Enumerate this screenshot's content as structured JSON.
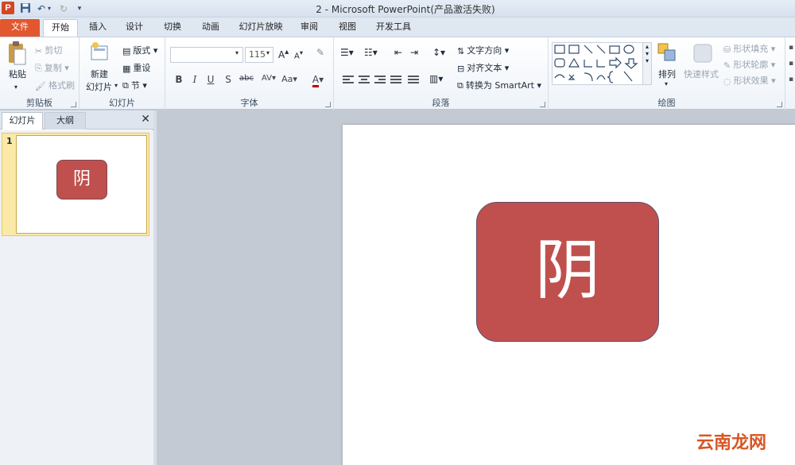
{
  "window": {
    "title": "2 - Microsoft PowerPoint(产品激活失败)"
  },
  "app_logo": "P",
  "tabs": [
    "文件",
    "开始",
    "插入",
    "设计",
    "切换",
    "动画",
    "幻灯片放映",
    "审阅",
    "视图",
    "开发工具"
  ],
  "ribbon": {
    "clipboard": {
      "paste": "粘贴",
      "cut": "剪切",
      "copy": "复制",
      "format_painter": "格式刷",
      "label": "剪贴板"
    },
    "slides": {
      "new_slide_line1": "新建",
      "new_slide_line2": "幻灯片",
      "layout": "版式",
      "reset": "重设",
      "section": "节",
      "label": "幻灯片"
    },
    "font": {
      "font_name": "",
      "font_size": "115",
      "label": "字体"
    },
    "paragraph": {
      "text_direction": "文字方向",
      "align_text": "对齐文本",
      "convert_smartart": "转换为 SmartArt",
      "label": "段落"
    },
    "drawing": {
      "arrange": "排列",
      "quick_styles": "快速样式",
      "shape_fill": "形状填充",
      "shape_outline": "形状轮廓",
      "shape_effects": "形状效果",
      "label": "绘图"
    }
  },
  "pane": {
    "tab_slides": "幻灯片",
    "tab_outline": "大纲",
    "close": "✕",
    "slide_number": "1"
  },
  "slide": {
    "shape_text": "阴",
    "shape_color": "#C0504D"
  },
  "watermark": "云南龙网"
}
